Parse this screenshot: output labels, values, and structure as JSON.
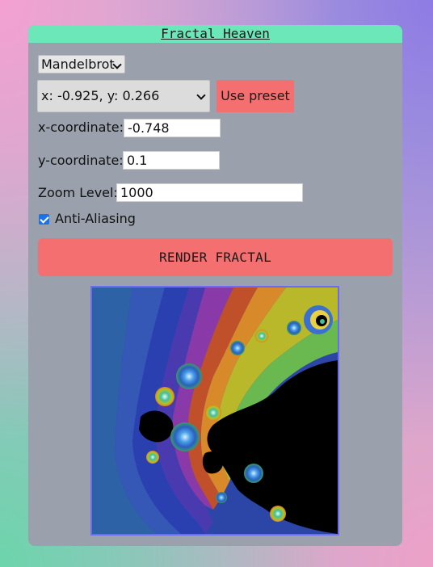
{
  "app": {
    "title": "Fractal Heaven"
  },
  "controls": {
    "fractal_type": {
      "selected": "Mandelbrot"
    },
    "preset": {
      "selected": "x: -0.925, y: 0.266"
    },
    "use_preset_label": "Use preset",
    "x_label": "x-coordinate:",
    "x_value": "-0.748",
    "y_label": "y-coordinate:",
    "y_value": "0.1",
    "zoom_label": "Zoom Level:",
    "zoom_value": "1000",
    "antialias_label": "Anti-Aliasing",
    "antialias_checked": true,
    "render_label": "RENDER FRACTAL"
  },
  "colors": {
    "title_bar": "#6ce7b9",
    "panel": "#9aa1ac",
    "button": "#f47070",
    "canvas_border": "#6c6cf0",
    "checkbox": "#1a73e8"
  }
}
